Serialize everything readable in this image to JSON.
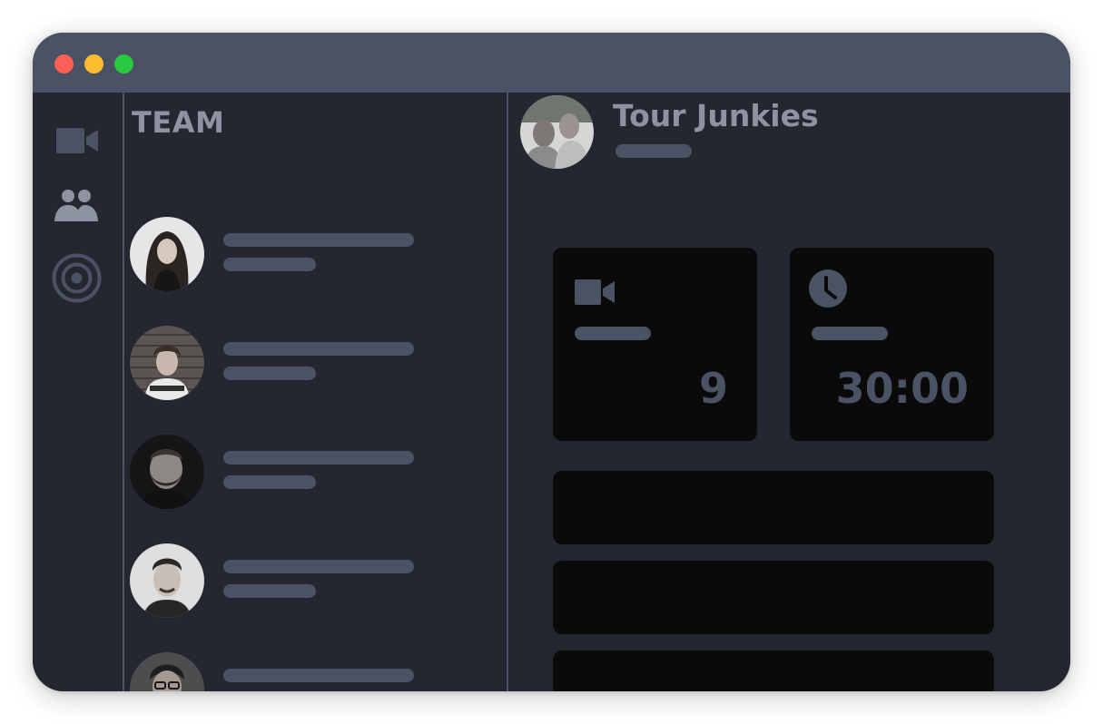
{
  "window": {
    "controls": [
      "close",
      "minimize",
      "zoom"
    ]
  },
  "rail": {
    "items": [
      {
        "icon": "video-camera-icon"
      },
      {
        "icon": "users-icon"
      },
      {
        "icon": "target-icon"
      }
    ]
  },
  "team_panel": {
    "title": "TEAM",
    "members": [
      {
        "avatar": "member-photo"
      },
      {
        "avatar": "member-photo"
      },
      {
        "avatar": "member-photo"
      },
      {
        "avatar": "member-photo"
      },
      {
        "avatar": "member-photo"
      }
    ]
  },
  "main": {
    "team_name": "Tour Junkies",
    "stats": [
      {
        "icon": "video-camera-icon",
        "value": "9"
      },
      {
        "icon": "clock-icon",
        "value": "30:00"
      }
    ],
    "rows": 3
  },
  "colors": {
    "titlebar": "#4a5264",
    "background": "#24272f",
    "card": "#0a0a0a",
    "placeholder": "#4a5264",
    "text": "#8e93a2"
  }
}
